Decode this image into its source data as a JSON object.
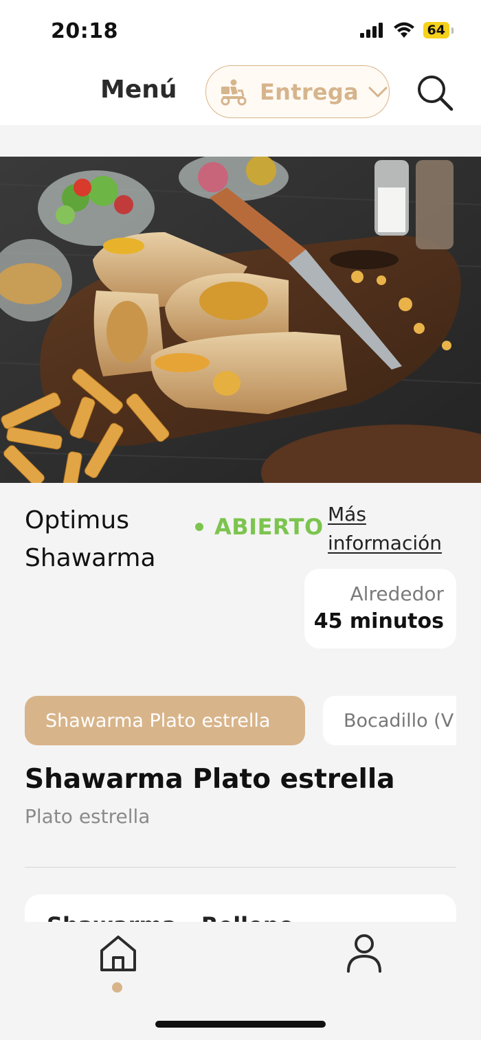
{
  "status_bar": {
    "time": "20:18",
    "battery": "64"
  },
  "header": {
    "title": "Menú",
    "delivery_mode": "Entrega"
  },
  "restaurant": {
    "name_line1": "Optimus",
    "name_line2": "Shawarma",
    "status": "ABIERTO",
    "more_info_line1": "Más",
    "more_info_line2": "información",
    "time_label": "Alrededor",
    "time_value": "45 minutos"
  },
  "categories": [
    {
      "label": "Shawarma Plato estrella",
      "active": true
    },
    {
      "label": "Bocadillo (V",
      "active": false
    }
  ],
  "section": {
    "title": "Shawarma Plato estrella",
    "subtitle": "Plato estrella"
  },
  "products": [
    {
      "name": "Shawarma - Relleno"
    }
  ],
  "colors": {
    "accent": "#d8b48a",
    "open_green": "#7cc44f",
    "background": "#f4f4f4"
  },
  "icons": {
    "delivery": "delivery-scooter-icon",
    "search": "search-icon",
    "home": "home-icon",
    "profile": "profile-icon"
  }
}
